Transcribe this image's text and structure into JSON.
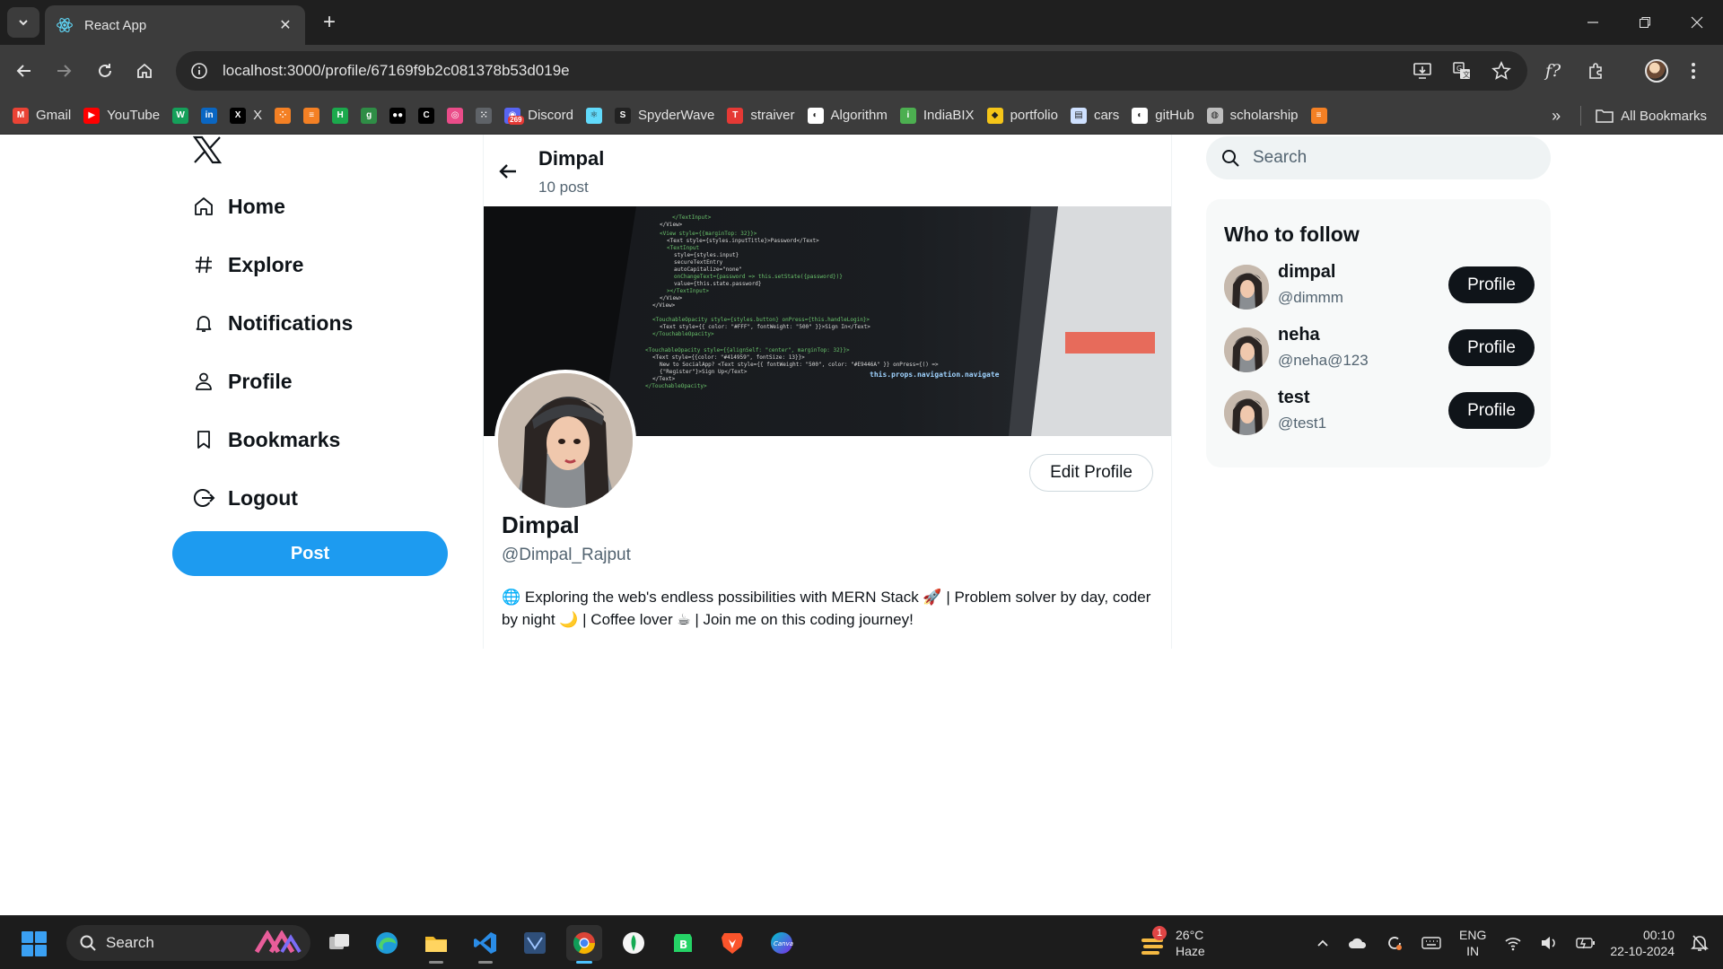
{
  "browser": {
    "tab_title": "React App",
    "url": "localhost:3000/profile/67169f9b2c081378b53d019e",
    "bookmarks": [
      {
        "label": "Gmail",
        "icon": "gmail-icon",
        "color": "#ea4335"
      },
      {
        "label": "YouTube",
        "icon": "youtube-icon",
        "color": "#ff0000"
      },
      {
        "label": "",
        "icon": "w-icon",
        "color": "#15a05a"
      },
      {
        "label": "",
        "icon": "linkedin-icon",
        "color": "#0a66c2"
      },
      {
        "label": "X",
        "icon": "x-icon",
        "color": "#000000"
      },
      {
        "label": "",
        "icon": "dots-icon",
        "color": "#f48024"
      },
      {
        "label": "",
        "icon": "stack-icon",
        "color": "#f48024"
      },
      {
        "label": "",
        "icon": "hackerrank-icon",
        "color": "#1ba94c"
      },
      {
        "label": "",
        "icon": "gfg-icon",
        "color": "#2f8d46"
      },
      {
        "label": "",
        "icon": "medium-icon",
        "color": "#000000"
      },
      {
        "label": "",
        "icon": "codechef-icon",
        "color": "#000000"
      },
      {
        "label": "",
        "icon": "dribbble-icon",
        "color": "#ea4c89"
      },
      {
        "label": "",
        "icon": "apps-icon",
        "color": "#5f6368"
      },
      {
        "label": "Discord",
        "icon": "discord-icon",
        "color": "#5865f2",
        "badge": "269"
      },
      {
        "label": "",
        "icon": "react-icon",
        "color": "#61dafb"
      },
      {
        "label": "SpyderWave",
        "icon": "spyder-icon",
        "color": "#222222"
      },
      {
        "label": "straiver",
        "icon": "tuf-icon",
        "color": "#e53935"
      },
      {
        "label": "Algorithm",
        "icon": "github-icon",
        "color": "#ffffff"
      },
      {
        "label": "IndiaBIX",
        "icon": "indiabix-icon",
        "color": "#4caf50"
      },
      {
        "label": "portfolio",
        "icon": "portfolio-icon",
        "color": "#f5c518"
      },
      {
        "label": "cars",
        "icon": "doc-icon",
        "color": "#cfe1ff"
      },
      {
        "label": "gitHub",
        "icon": "github-icon",
        "color": "#ffffff"
      },
      {
        "label": "scholarship",
        "icon": "globe-icon",
        "color": "#bdbdbd"
      },
      {
        "label": "",
        "icon": "stack-icon",
        "color": "#f48024"
      }
    ],
    "all_bookmarks_label": "All Bookmarks"
  },
  "sidebar": {
    "items": [
      {
        "label": "Home",
        "icon": "home-icon"
      },
      {
        "label": "Explore",
        "icon": "hashtag-icon"
      },
      {
        "label": "Notifications",
        "icon": "bell-icon"
      },
      {
        "label": "Profile",
        "icon": "person-icon"
      },
      {
        "label": "Bookmarks",
        "icon": "bookmark-icon"
      },
      {
        "label": "Logout",
        "icon": "logout-icon"
      }
    ],
    "post_label": "Post"
  },
  "profile": {
    "header_name": "Dimpal",
    "post_count": "10 post",
    "edit_label": "Edit Profile",
    "name": "Dimpal",
    "handle": "@Dimpal_Rajput",
    "bio": "🌐 Exploring the web's endless possibilities with MERN Stack 🚀 | Problem solver by day, coder by night 🌙 | Coffee lover ☕ | Join me on this coding journey!"
  },
  "right": {
    "search_placeholder": "Search",
    "who_to_follow_title": "Who to follow",
    "suggestions": [
      {
        "name": "dimpal",
        "handle": "@dimmm",
        "button": "Profile"
      },
      {
        "name": "neha",
        "handle": "@neha@123",
        "button": "Profile"
      },
      {
        "name": "test",
        "handle": "@test1",
        "button": "Profile"
      }
    ]
  },
  "taskbar": {
    "search_label": "Search",
    "weather_temp": "26°C",
    "weather_desc": "Haze",
    "weather_badge": "1",
    "lang_top": "ENG",
    "lang_bottom": "IN",
    "time": "00:10",
    "date": "22-10-2024"
  },
  "colors": {
    "accent": "#1d9bf0",
    "text_primary": "#0f1419",
    "text_secondary": "#536471"
  }
}
